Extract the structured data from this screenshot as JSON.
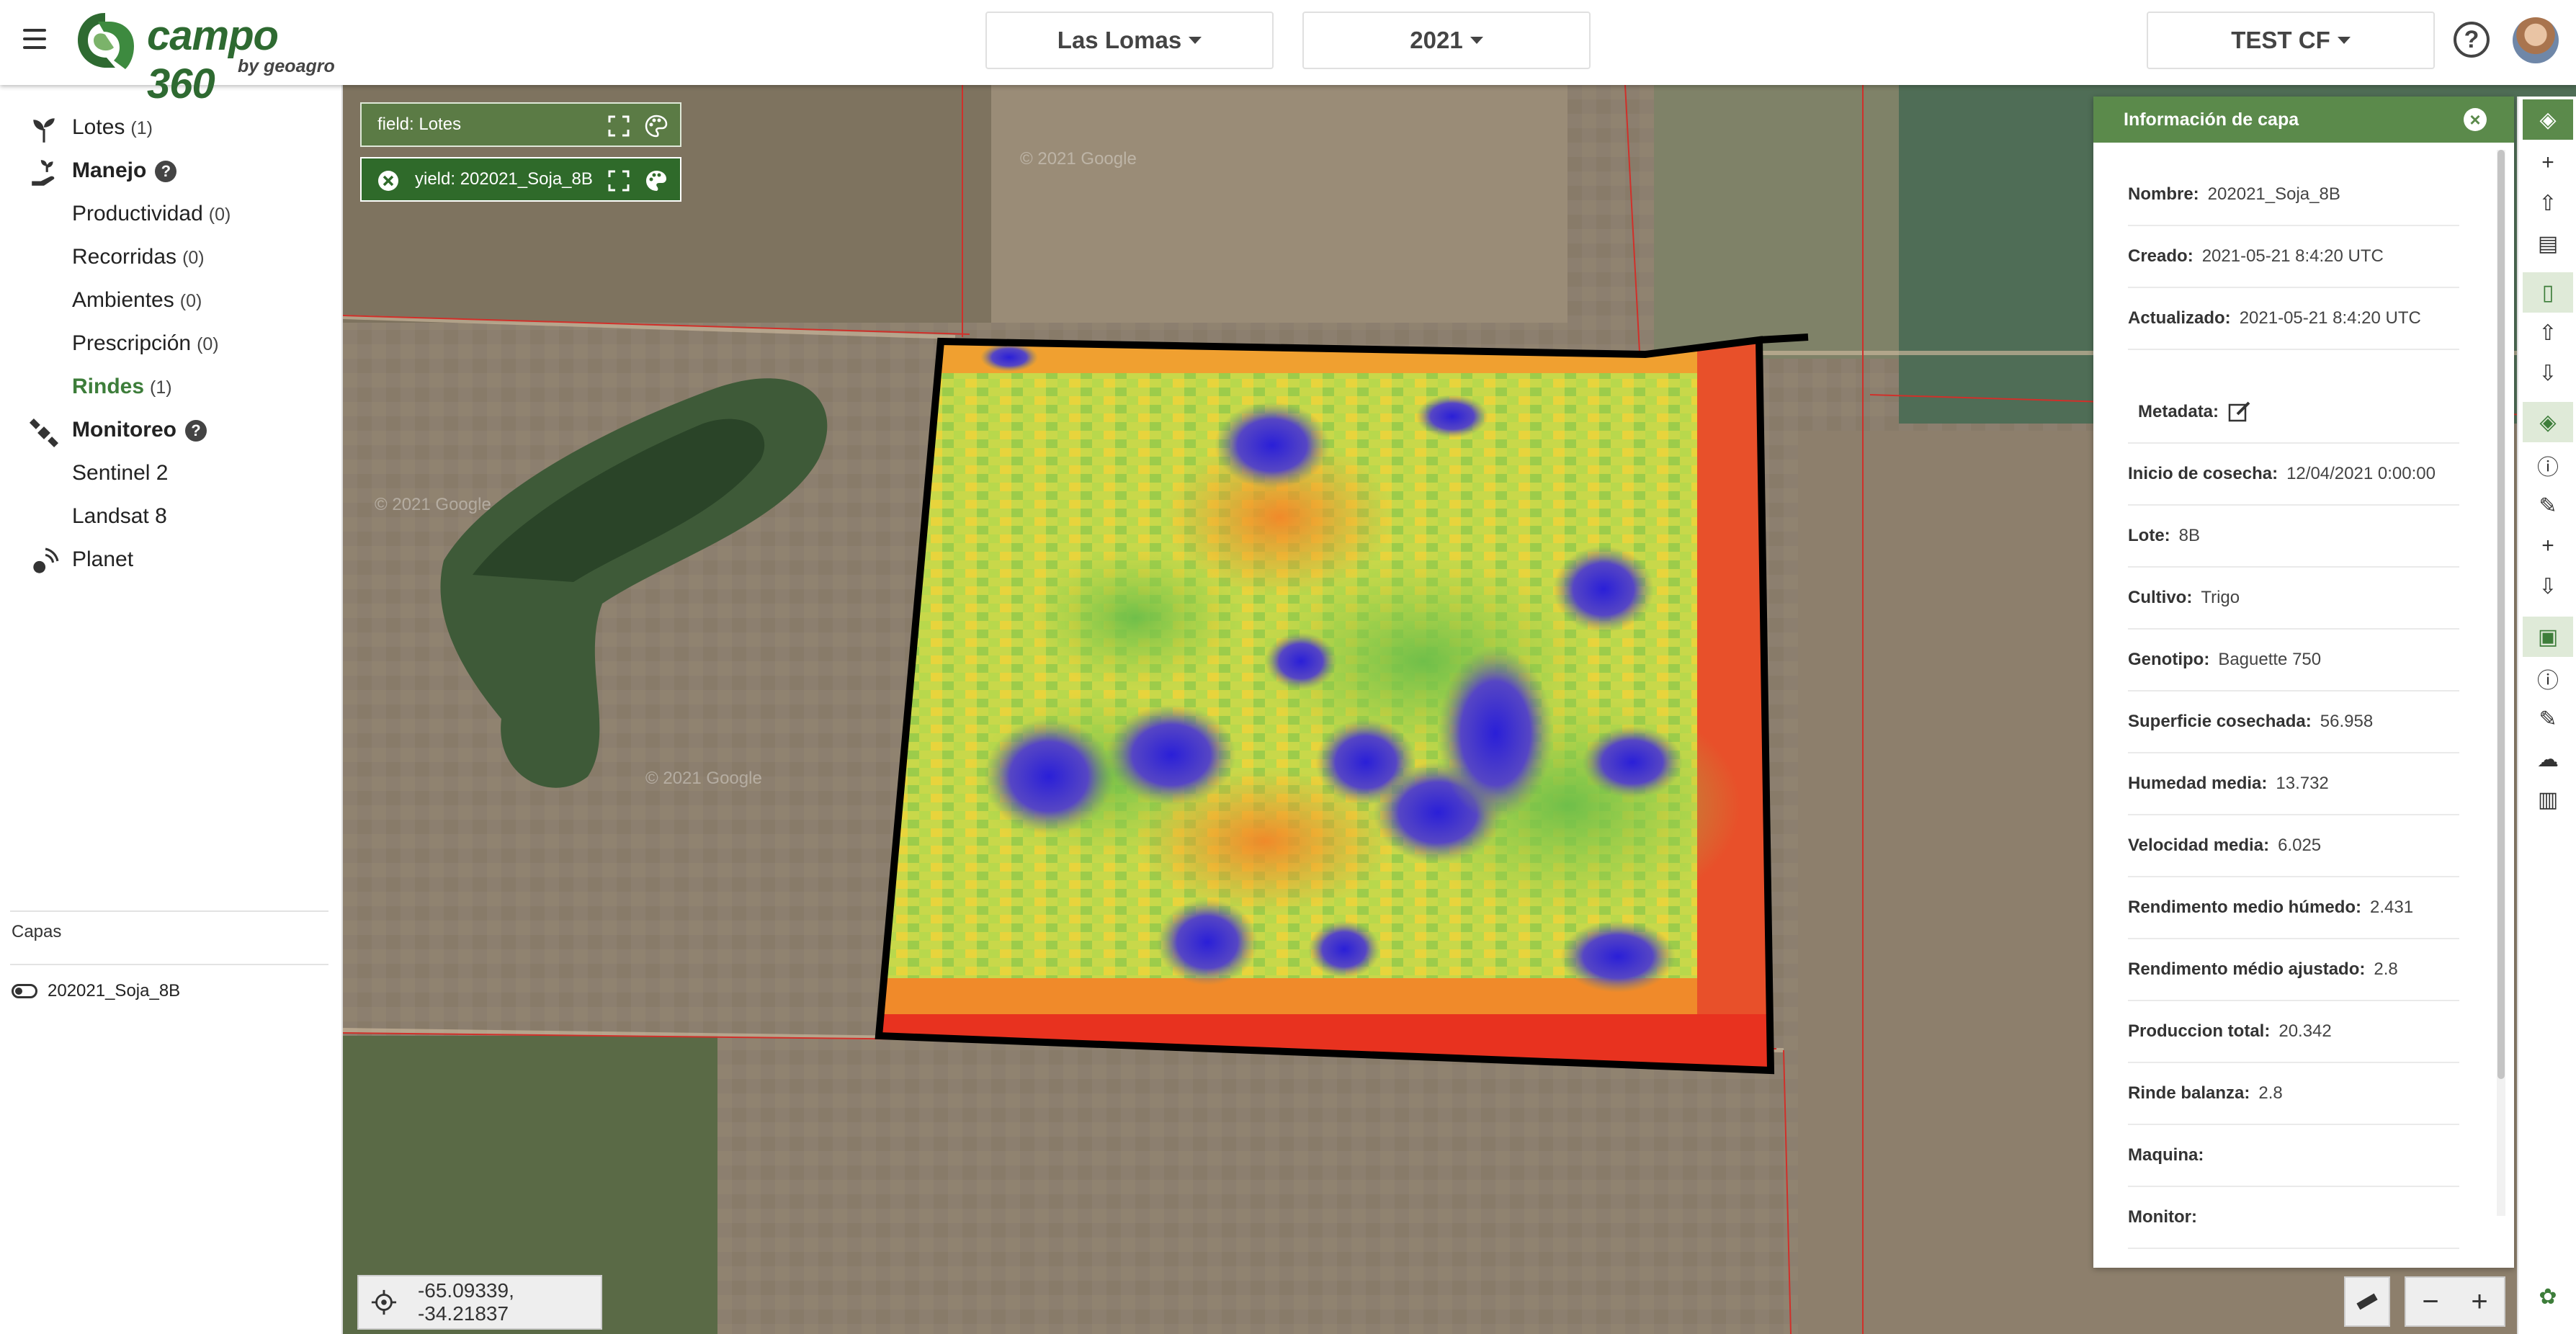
{
  "app": {
    "name": "campo 360",
    "sub": "by geoagro"
  },
  "header": {
    "establishment": "Las Lomas",
    "year": "2021",
    "account": "TEST CF"
  },
  "sidebar": {
    "items": [
      {
        "label": "Lotes",
        "count": "(1)"
      },
      {
        "label": "Manejo"
      },
      {
        "label": "Productividad",
        "count": "(0)"
      },
      {
        "label": "Recorridas",
        "count": "(0)"
      },
      {
        "label": "Ambientes",
        "count": "(0)"
      },
      {
        "label": "Prescripción",
        "count": "(0)"
      },
      {
        "label": "Rindes",
        "count": "(1)"
      },
      {
        "label": "Monitoreo"
      },
      {
        "label": "Sentinel 2"
      },
      {
        "label": "Landsat 8"
      },
      {
        "label": "Planet"
      }
    ],
    "capas_title": "Capas",
    "layer_name": "202021_Soja_8B"
  },
  "map": {
    "field_label": "field: Lotes",
    "yield_label": "yield: 202021_Soja_8B",
    "coords": "-65.09339, -34.21837",
    "watermark": "© 2021 Google"
  },
  "panel": {
    "title": "Información de capa",
    "rows": [
      {
        "k": "Nombre:",
        "v": "202021_Soja_8B"
      },
      {
        "k": "Creado:",
        "v": "2021-05-21 8:4:20 UTC"
      },
      {
        "k": "Actualizado:",
        "v": "2021-05-21 8:4:20 UTC"
      },
      {
        "k": "Metadata:",
        "v": ""
      },
      {
        "k": "Inicio de cosecha:",
        "v": "12/04/2021 0:00:00"
      },
      {
        "k": "Lote:",
        "v": "8B"
      },
      {
        "k": "Cultivo:",
        "v": "Trigo"
      },
      {
        "k": "Genotipo:",
        "v": "Baguette 750"
      },
      {
        "k": "Superficie cosechada:",
        "v": "56.958"
      },
      {
        "k": "Humedad media:",
        "v": "13.732"
      },
      {
        "k": "Velocidad media:",
        "v": "6.025"
      },
      {
        "k": "Rendimento medio húmedo:",
        "v": "2.431"
      },
      {
        "k": "Rendimento médio ajustado:",
        "v": "2.8"
      },
      {
        "k": "Produccion total:",
        "v": "20.342"
      },
      {
        "k": "Rinde balanza:",
        "v": "2.8"
      },
      {
        "k": "Maquina:",
        "v": ""
      },
      {
        "k": "Monitor:",
        "v": ""
      }
    ]
  },
  "colors": {
    "brand": "#2e6a31",
    "accent": "#5b8a4b",
    "yield_high": "#3a2ed6",
    "yield_low": "#e8321f"
  }
}
